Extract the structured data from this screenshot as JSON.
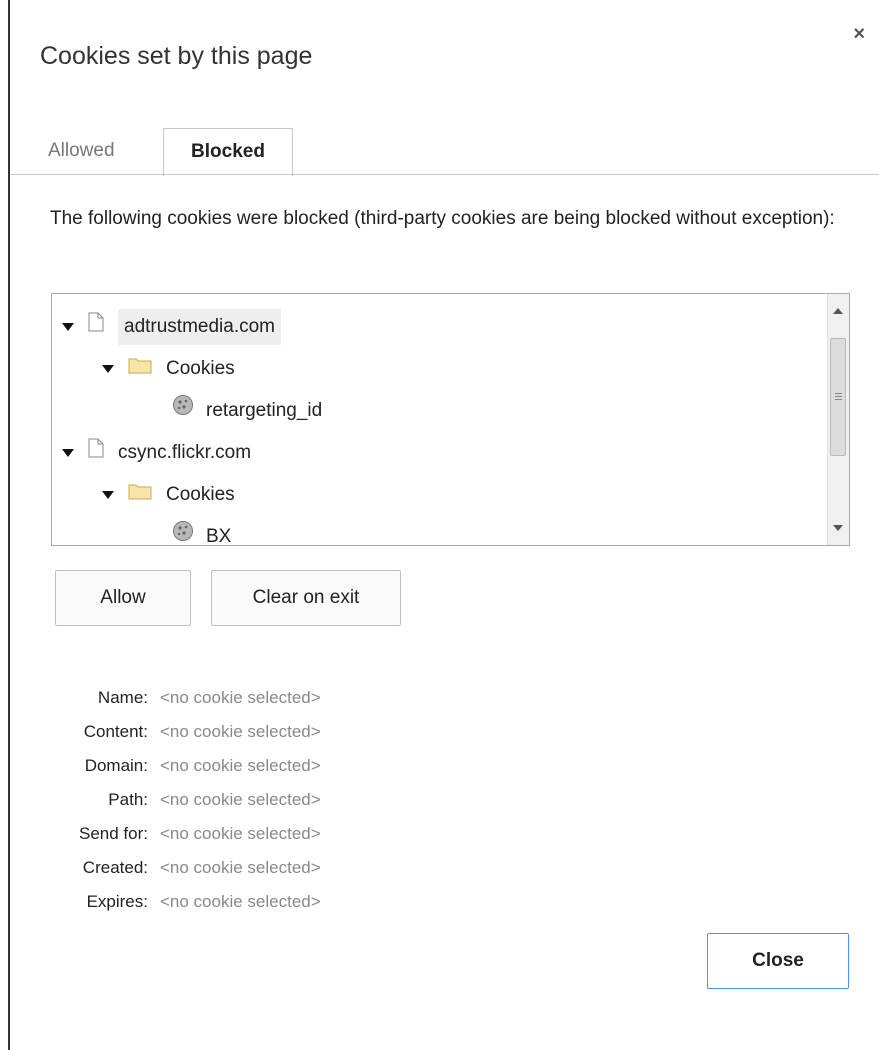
{
  "dialog": {
    "title": "Cookies set by this page",
    "close_glyph": "×"
  },
  "tabs": [
    {
      "label": "Allowed",
      "selected": false
    },
    {
      "label": "Blocked",
      "selected": true
    }
  ],
  "description": "The following cookies were blocked (third-party cookies are being blocked without exception):",
  "tree": {
    "items": [
      {
        "label": "adtrustmedia.com",
        "type": "site",
        "expanded": true,
        "highlighted": true
      },
      {
        "label": "Cookies",
        "type": "folder",
        "expanded": true
      },
      {
        "label": "retargeting_id",
        "type": "cookie"
      },
      {
        "label": "csync.flickr.com",
        "type": "site",
        "expanded": true
      },
      {
        "label": "Cookies",
        "type": "folder",
        "expanded": true
      },
      {
        "label": "BX",
        "type": "cookie"
      }
    ]
  },
  "buttons": {
    "allow": "Allow",
    "clear_on_exit": "Clear on exit",
    "close": "Close"
  },
  "details": [
    {
      "label": "Name:",
      "value": "<no cookie selected>"
    },
    {
      "label": "Content:",
      "value": "<no cookie selected>"
    },
    {
      "label": "Domain:",
      "value": "<no cookie selected>"
    },
    {
      "label": "Path:",
      "value": "<no cookie selected>"
    },
    {
      "label": "Send for:",
      "value": "<no cookie selected>"
    },
    {
      "label": "Created:",
      "value": "<no cookie selected>"
    },
    {
      "label": "Expires:",
      "value": "<no cookie selected>"
    }
  ],
  "icons": {
    "site": "file-icon",
    "folder": "folder-icon",
    "cookie": "cookie-icon",
    "expand": "expand-arrow-icon"
  },
  "colors": {
    "accent_border": "#4d90fe",
    "folder_fill": "#f8e4a8",
    "muted_text": "#888888"
  }
}
